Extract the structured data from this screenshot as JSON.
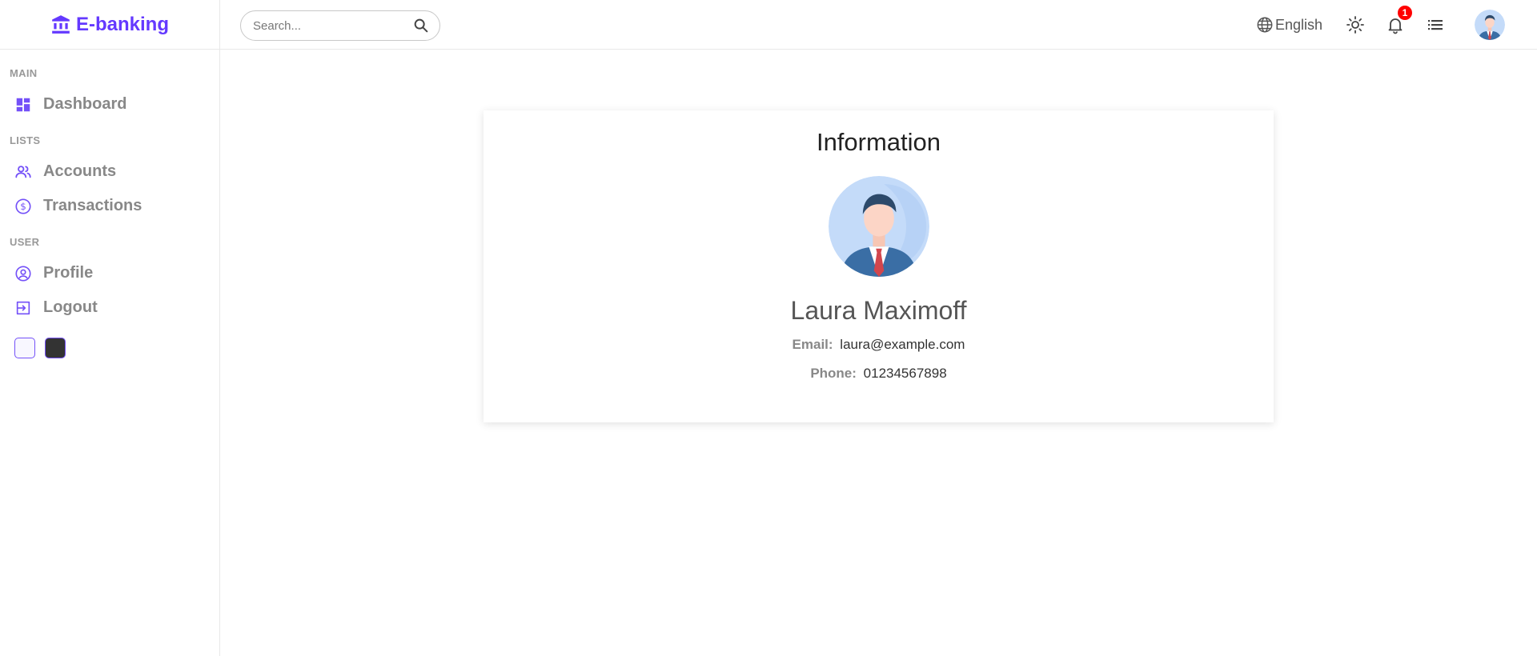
{
  "brand": {
    "name": "E-banking",
    "accent": "#6439ff"
  },
  "sidebar": {
    "sections": [
      {
        "title": "MAIN",
        "items": [
          {
            "label": "Dashboard",
            "icon": "dashboard-icon"
          }
        ]
      },
      {
        "title": "LISTS",
        "items": [
          {
            "label": "Accounts",
            "icon": "people-icon"
          },
          {
            "label": "Transactions",
            "icon": "dollar-circle-icon"
          }
        ]
      },
      {
        "title": "USER",
        "items": [
          {
            "label": "Profile",
            "icon": "account-circle-icon"
          },
          {
            "label": "Logout",
            "icon": "logout-icon"
          }
        ]
      }
    ],
    "themes": [
      {
        "name": "light",
        "color": "#f8f7ff"
      },
      {
        "name": "dark",
        "color": "#333333"
      }
    ]
  },
  "topbar": {
    "search": {
      "placeholder": "Search...",
      "value": ""
    },
    "language": "English",
    "notifications_count": "1"
  },
  "info_card": {
    "title": "Information",
    "name": "Laura Maximoff",
    "email_label": "Email:",
    "email": "laura@example.com",
    "phone_label": "Phone:",
    "phone": "01234567898"
  }
}
